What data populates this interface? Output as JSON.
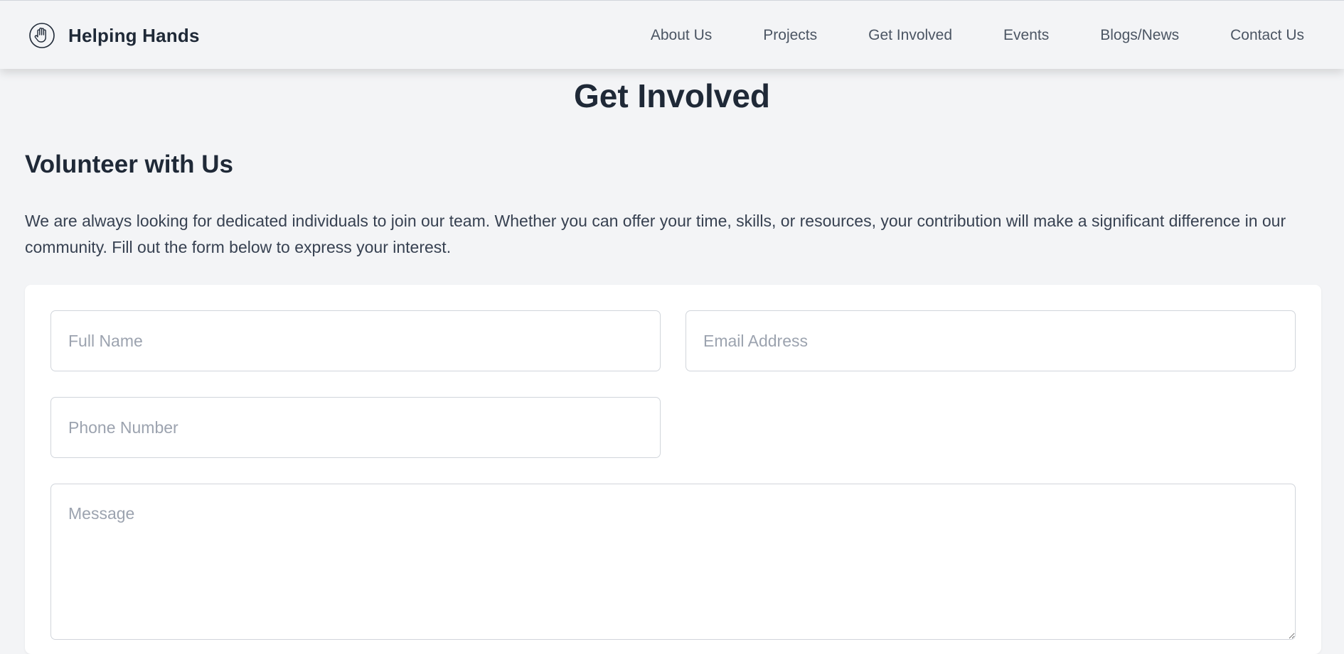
{
  "header": {
    "brand_name": "Helping Hands",
    "brand_icon": "raised-hand-icon",
    "nav": [
      {
        "label": "About Us"
      },
      {
        "label": "Projects"
      },
      {
        "label": "Get Involved"
      },
      {
        "label": "Events"
      },
      {
        "label": "Blogs/News"
      },
      {
        "label": "Contact Us"
      }
    ]
  },
  "main": {
    "page_title": "Get Involved",
    "section_title": "Volunteer with Us",
    "intro_text": "We are always looking for dedicated individuals to join our team. Whether you can offer your time, skills, or resources, your contribution will make a significant difference in our community. Fill out the form below to express your interest."
  },
  "form": {
    "full_name": {
      "value": "",
      "placeholder": "Full Name"
    },
    "email": {
      "value": "",
      "placeholder": "Email Address"
    },
    "phone": {
      "value": "",
      "placeholder": "Phone Number"
    },
    "message": {
      "value": "",
      "placeholder": "Message"
    }
  },
  "colors": {
    "background": "#f3f4f6",
    "card": "#ffffff",
    "text_dark": "#1f2937",
    "nav_text": "#4b5563",
    "placeholder": "#9ca3af",
    "border": "#d1d5db"
  }
}
